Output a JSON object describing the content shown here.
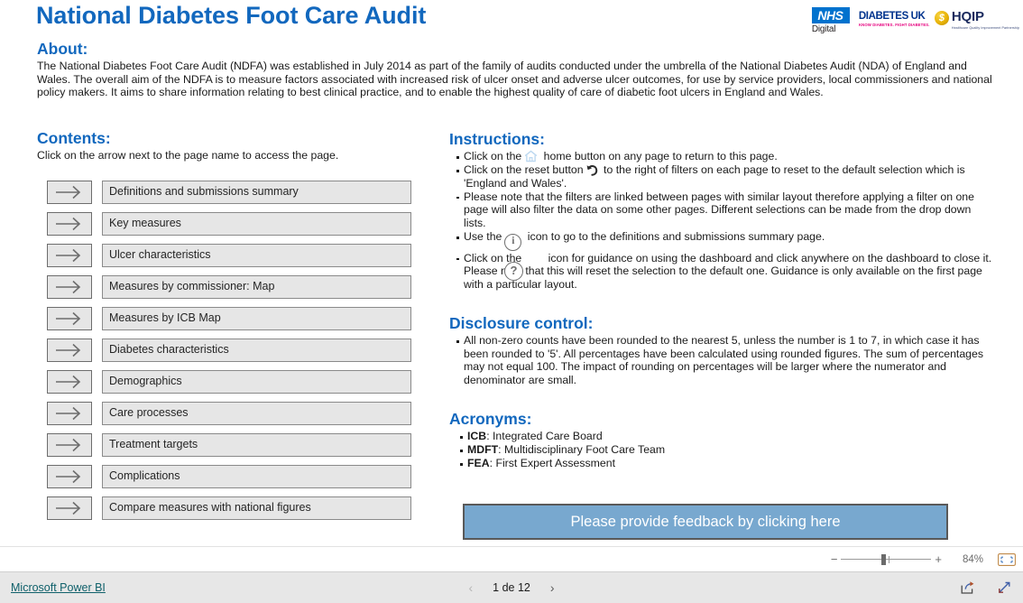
{
  "report": {
    "title": "National Diabetes Foot Care Audit"
  },
  "logos": {
    "nhs": {
      "mark": "NHS",
      "sub": "Digital"
    },
    "diabetes_uk": {
      "main": "DIABETES UK",
      "sub": "KNOW DIABETES. FIGHT DIABETES."
    },
    "hqip": {
      "coin": "$",
      "name": "HQIP",
      "sub": "Healthcare Quality Improvement Partnership"
    }
  },
  "about": {
    "heading": "About:",
    "text": "The National Diabetes Foot Care Audit (NDFA) was established in July 2014 as part of the family of audits conducted under the umbrella of the National Diabetes Audit (NDA) of England and Wales. The overall aim of the NDFA is to measure factors associated with increased risk of ulcer onset and adverse ulcer outcomes, for use by service providers, local commissioners and national policy makers. It aims to share information relating to best clinical practice, and to enable the highest quality of care of diabetic foot ulcers in England and Wales."
  },
  "contents": {
    "heading": "Contents:",
    "subtext": "Click on the arrow next to the page name to access the page.",
    "items": [
      {
        "label": "Definitions and submissions summary"
      },
      {
        "label": "Key measures"
      },
      {
        "label": "Ulcer characteristics"
      },
      {
        "label": "Measures by commissioner: Map"
      },
      {
        "label": "Measures by ICB Map"
      },
      {
        "label": "Diabetes characteristics"
      },
      {
        "label": "Demographics"
      },
      {
        "label": "Care processes"
      },
      {
        "label": "Treatment targets"
      },
      {
        "label": "Complications"
      },
      {
        "label": "Compare measures with national figures"
      }
    ]
  },
  "instructions": {
    "heading": "Instructions:",
    "items": [
      {
        "before": "Click on the",
        "icon": "home-icon",
        "after": "home button on any page to return to this page."
      },
      {
        "before": "Click on the reset button",
        "icon": "reset-icon",
        "after": "to the right of filters on each page to reset to the default selection which is 'England and Wales'."
      },
      {
        "before": "Please note that the filters are linked between pages with similar layout therefore applying a filter on one page will also filter the data on some other pages. Different selections can be made from the drop down lists.",
        "icon": "",
        "after": ""
      },
      {
        "before": "Use the",
        "icon": "info-icon",
        "after": "icon to go to the definitions and submissions summary page."
      },
      {
        "before": "Click on the",
        "icon": "question-icon",
        "after": "icon for guidance on using the dashboard and click anywhere on the dashboard to close it. Please note that this will reset the selection to the default one. Guidance is only available on the first page with a particular layout."
      }
    ]
  },
  "disclosure": {
    "heading": "Disclosure control:",
    "items": [
      "All non-zero counts have been rounded to the nearest 5, unless the number is 1 to 7, in which case it has been rounded to '5'. All percentages have been calculated using rounded figures. The sum of percentages may not equal 100. The impact of rounding on percentages will be larger where the numerator and denominator are small."
    ]
  },
  "acronyms": {
    "heading": "Acronyms:",
    "items": [
      {
        "term": "ICB",
        "definition": ": Integrated Care Board"
      },
      {
        "term": "MDFT",
        "definition": ": Multidisciplinary Foot Care Team"
      },
      {
        "term": "FEA",
        "definition": ": First Expert Assessment"
      }
    ]
  },
  "feedback": {
    "label": "Please provide feedback by clicking here"
  },
  "zoombar": {
    "minus": "−",
    "plus": "+",
    "percent": "84%"
  },
  "statusbar": {
    "powerbi_link": "Microsoft Power BI",
    "prev": "‹",
    "page": "1 de 12",
    "next": "›"
  },
  "colors": {
    "heading_blue": "#1268BE",
    "nhs_blue": "#0072CE",
    "diabetes_navy": "#00338d",
    "diabetes_pink": "#e6007e",
    "hqip_navy": "#1b2a5e",
    "hqip_gold": "#e8b307",
    "feedback_bg": "#78A8CF",
    "nav_bg": "#e6e6e6",
    "link_teal": "#10616b"
  }
}
